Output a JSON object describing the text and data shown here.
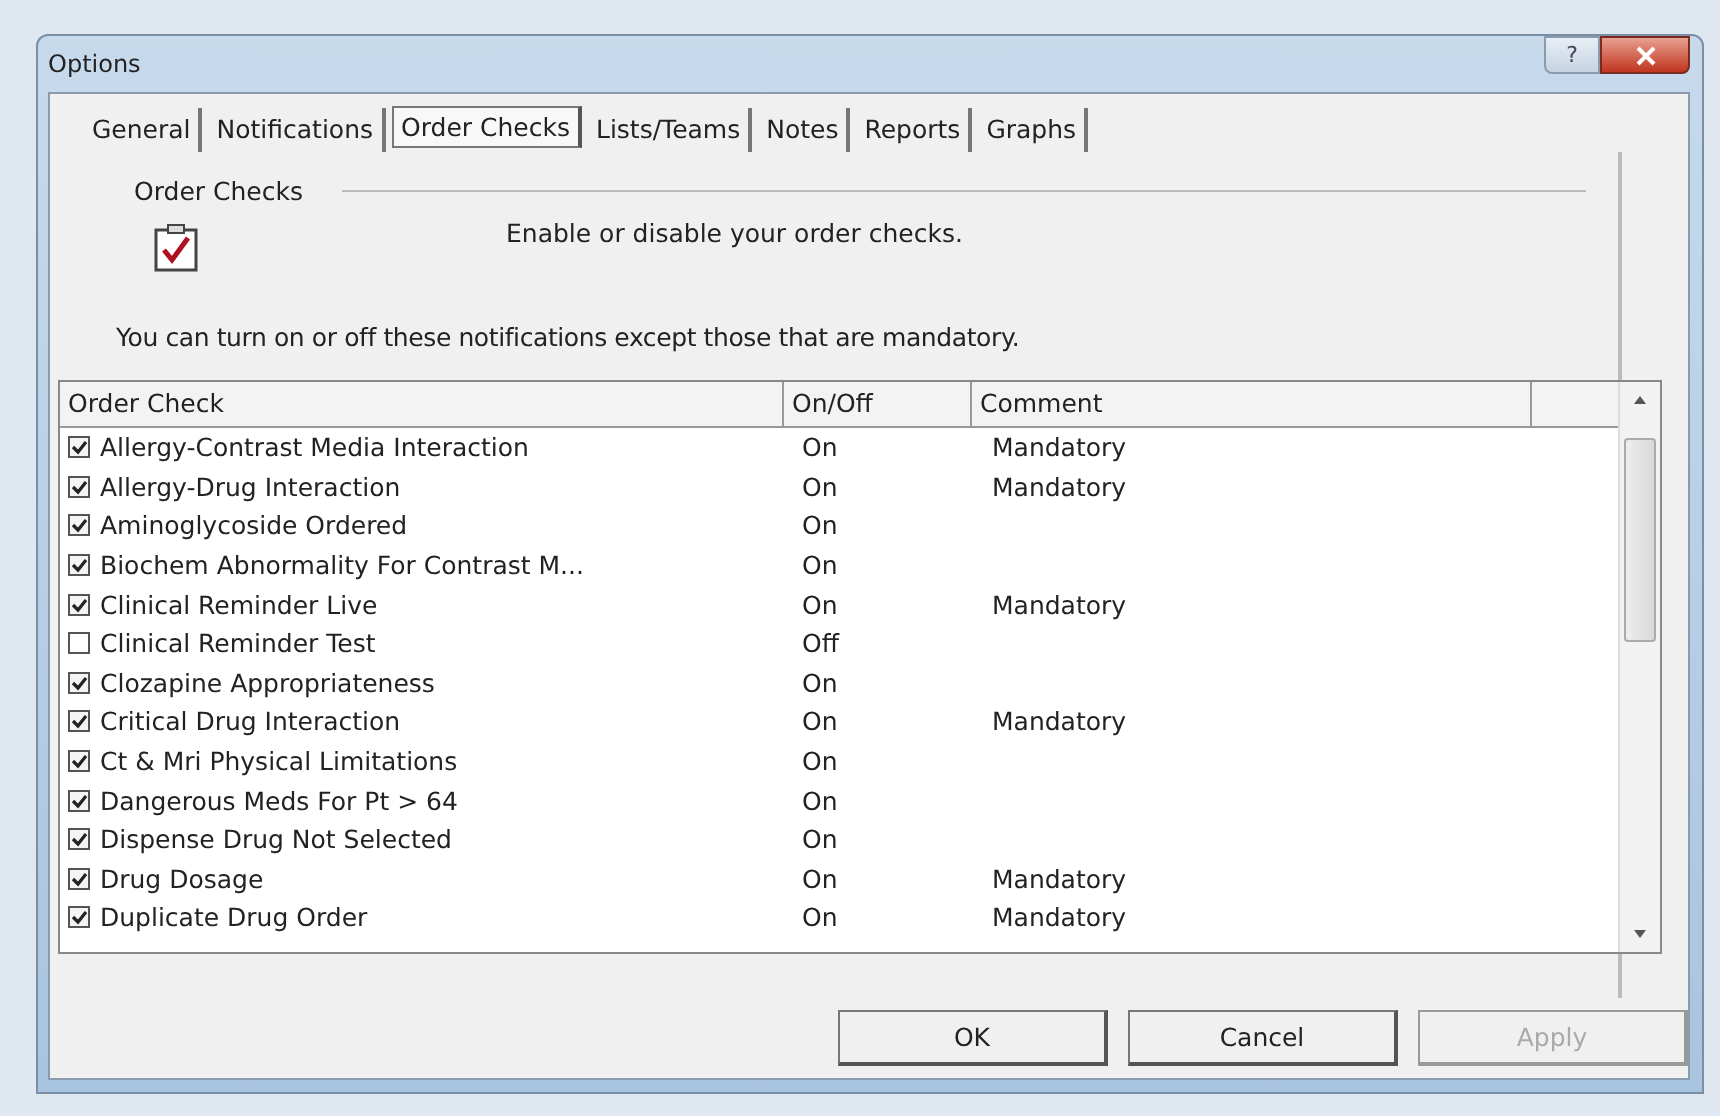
{
  "window": {
    "title": "Options",
    "help": "?"
  },
  "tabs": [
    {
      "label": "General",
      "selected": false
    },
    {
      "label": "Notifications",
      "selected": false
    },
    {
      "label": "Order Checks",
      "selected": true
    },
    {
      "label": "Lists/Teams",
      "selected": false
    },
    {
      "label": "Notes",
      "selected": false
    },
    {
      "label": "Reports",
      "selected": false
    },
    {
      "label": "Graphs",
      "selected": false
    }
  ],
  "group": {
    "title": "Order Checks",
    "description": "Enable or disable your order checks.",
    "note": "You can turn on or off these notifications except those that are mandatory."
  },
  "table": {
    "columns": [
      "Order Check",
      "On/Off",
      "Comment"
    ],
    "rows": [
      {
        "name": "Allergy-Contrast Media Interaction",
        "checked": true,
        "status": "On",
        "comment": "Mandatory"
      },
      {
        "name": "Allergy-Drug Interaction",
        "checked": true,
        "status": "On",
        "comment": "Mandatory"
      },
      {
        "name": "Aminoglycoside Ordered",
        "checked": true,
        "status": "On"
      },
      {
        "name": "Biochem Abnormality For Contrast M...",
        "checked": true,
        "status": "On"
      },
      {
        "name": "Clinical Reminder Live",
        "checked": true,
        "status": "On",
        "comment": "Mandatory"
      },
      {
        "name": "Clinical Reminder Test",
        "checked": false,
        "status": "Off"
      },
      {
        "name": "Clozapine Appropriateness",
        "checked": true,
        "status": "On"
      },
      {
        "name": "Critical Drug Interaction",
        "checked": true,
        "status": "On",
        "comment": "Mandatory"
      },
      {
        "name": "Ct & Mri Physical Limitations",
        "checked": true,
        "status": "On"
      },
      {
        "name": "Dangerous Meds For Pt > 64",
        "checked": true,
        "status": "On"
      },
      {
        "name": "Dispense Drug Not Selected",
        "checked": true,
        "status": "On"
      },
      {
        "name": "Drug Dosage",
        "checked": true,
        "status": "On",
        "comment": "Mandatory"
      },
      {
        "name": "Duplicate Drug Order",
        "checked": true,
        "status": "On",
        "comment": "Mandatory"
      }
    ]
  },
  "buttons": [
    {
      "label": "OK",
      "disabled": false
    },
    {
      "label": "Cancel",
      "disabled": false
    },
    {
      "label": "Apply",
      "disabled": true
    }
  ]
}
